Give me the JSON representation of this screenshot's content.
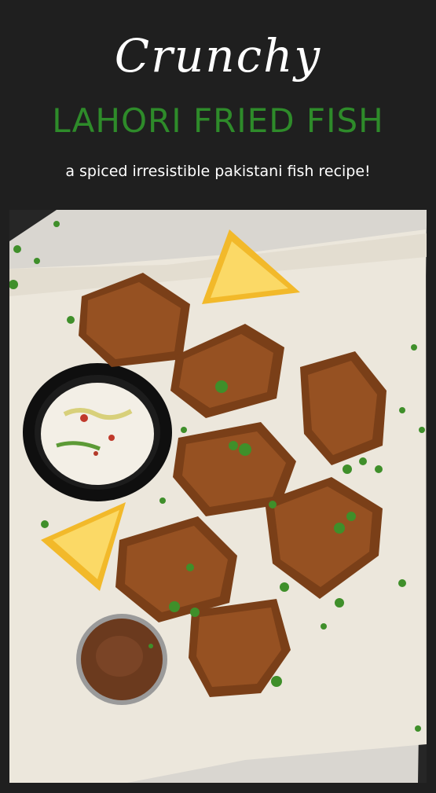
{
  "header": {
    "script_title": "Crunchy",
    "main_title": "LAHORI FRIED FISH",
    "subtitle": "a spiced irresistible pakistani fish recipe!"
  },
  "photo": {
    "colors": {
      "background": "#1f1f1f",
      "parchment": "#ece7dc",
      "fish": "#8a4a1f",
      "lemon": "#f6c63a",
      "bowl": "#141414",
      "sauce": "#f3efe6",
      "cilantro": "#3f8f2a",
      "spice": "#6b3a1e"
    }
  }
}
